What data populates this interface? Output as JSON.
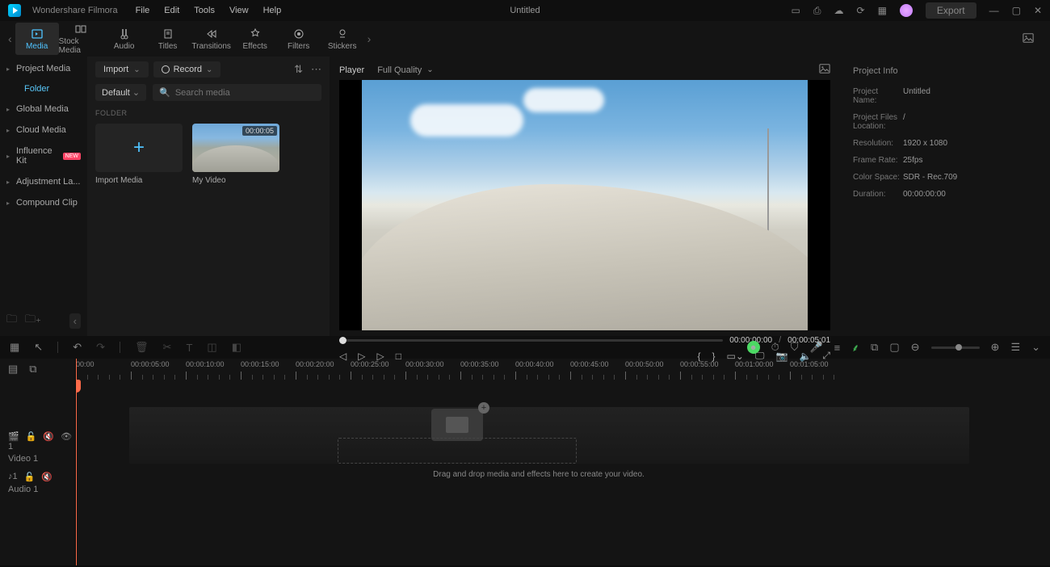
{
  "app": {
    "name": "Wondershare Filmora",
    "doc": "Untitled"
  },
  "menu": [
    "File",
    "Edit",
    "Tools",
    "View",
    "Help"
  ],
  "export": "Export",
  "ribbon": [
    {
      "label": "Media",
      "active": true
    },
    {
      "label": "Stock Media"
    },
    {
      "label": "Audio"
    },
    {
      "label": "Titles"
    },
    {
      "label": "Transitions"
    },
    {
      "label": "Effects"
    },
    {
      "label": "Filters"
    },
    {
      "label": "Stickers"
    }
  ],
  "sidebar": {
    "items": [
      "Project Media"
    ],
    "sub": "Folder",
    "rest": [
      "Global Media",
      "Cloud Media",
      "Influence Kit",
      "Adjustment La...",
      "Compound Clip"
    ],
    "badge": "NEW"
  },
  "media": {
    "import": "Import",
    "record": "Record",
    "default": "Default",
    "search_ph": "Search media",
    "folder": "FOLDER",
    "card_import": "Import Media",
    "card_video": "My Video",
    "dur": "00:00:05"
  },
  "preview": {
    "tab": "Player",
    "quality": "Full Quality",
    "cur": "00:00:00:00",
    "total": "00:00:05:01"
  },
  "info": {
    "title": "Project Info",
    "rows": [
      {
        "l": "Project Name:",
        "v": "Untitled"
      },
      {
        "l": "Project Files Location:",
        "v": "/"
      },
      {
        "l": "Resolution:",
        "v": "1920 x 1080"
      },
      {
        "l": "Frame Rate:",
        "v": "25fps"
      },
      {
        "l": "Color Space:",
        "v": "SDR - Rec.709"
      },
      {
        "l": "Duration:",
        "v": "00:00:00:00"
      }
    ]
  },
  "timeline": {
    "marks": [
      "00:00",
      "00:00:05:00",
      "00:00:10:00",
      "00:00:15:00",
      "00:00:20:00",
      "00:00:25:00",
      "00:00:30:00",
      "00:00:35:00",
      "00:00:40:00",
      "00:00:45:00",
      "00:00:50:00",
      "00:00:55:00",
      "00:01:00:00",
      "00:01:05:00"
    ],
    "video_track": "Video 1",
    "audio_track": "Audio 1",
    "drop_text": "Drag and drop media and effects here to create your video."
  }
}
